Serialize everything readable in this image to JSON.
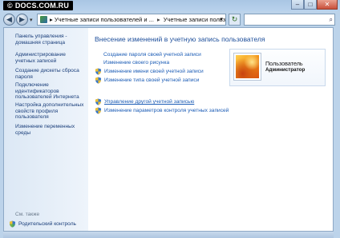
{
  "watermark": "DOCS.COM.RU",
  "watermark_symbol": "©",
  "window_buttons": {
    "minimize": "–",
    "maximize": "□",
    "close": "✕"
  },
  "navigation": {
    "back_glyph": "◀",
    "forward_glyph": "▶",
    "dropdown_glyph": "▾",
    "breadcrumb": [
      "Учетные записи пользователей и ...",
      "Учетные записи пользователей"
    ],
    "breadcrumb_sep": "▸",
    "refresh_glyph": "↻",
    "search_placeholder": "",
    "search_glyph": "⌕"
  },
  "sidebar": {
    "items": [
      "Панель управления - домашняя страница",
      "Администрирование учетных записей",
      "Создание дискеты сброса пароля",
      "Подключение идентификаторов пользователей Интернета",
      "Настройка дополнительных свойств профиля пользователя",
      "Изменение переменных среды"
    ],
    "see_also": "См. также",
    "parental_controls": "Родительский контроль"
  },
  "main": {
    "title": "Внесение изменений в учетную запись пользователя",
    "tasks": [
      {
        "label": "Создание пароля своей учетной записи",
        "shield": false
      },
      {
        "label": "Изменение своего рисунка",
        "shield": false
      },
      {
        "label": "Изменение имени своей учетной записи",
        "shield": true
      },
      {
        "label": "Изменение типа своей учетной записи",
        "shield": true
      }
    ],
    "tasks2": [
      {
        "label": "Управление другой учетной записью",
        "shield": true
      },
      {
        "label": "Изменение параметров контроля учетных записей",
        "shield": true
      }
    ]
  },
  "user": {
    "name": "Пользователь",
    "role": "Администратор"
  },
  "colors": {
    "link": "#1a5bb5",
    "title": "#1e4f9b",
    "frame": "#bcd3ea"
  }
}
